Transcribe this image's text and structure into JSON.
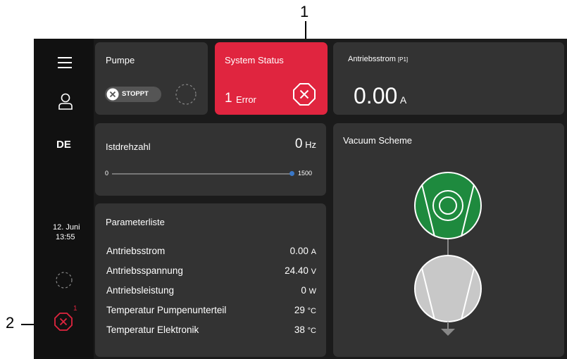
{
  "callouts": {
    "one": "1",
    "two": "2"
  },
  "sidebar": {
    "language": "DE",
    "date": "12. Juni",
    "time": "13:55",
    "error_badge": "1"
  },
  "pump": {
    "title": "Pumpe",
    "toggle_label": "STOPPT"
  },
  "system_status": {
    "title": "System Status",
    "count": "1",
    "label": "Error",
    "color": "#e0253f"
  },
  "drive_current": {
    "title": "Antriebsstrom",
    "tag": "[P1]",
    "value": "0.00",
    "unit": "A"
  },
  "speed": {
    "title": "Istdrehzahl",
    "value": "0",
    "unit": "Hz",
    "slider_min": "0",
    "slider_max": "1500",
    "slider_level": 1.0
  },
  "vacuum": {
    "title": "Vacuum Scheme",
    "upper_color": "#1e8a3e",
    "lower_color": "#c8c8c8"
  },
  "params": {
    "title": "Parameterliste",
    "rows": [
      {
        "name": "Antriebsstrom",
        "value": "0.00",
        "unit": "A"
      },
      {
        "name": "Antriebsspannung",
        "value": "24.40",
        "unit": "V"
      },
      {
        "name": "Antriebsleistung",
        "value": "0",
        "unit": "W"
      },
      {
        "name": "Temperatur Pumpenunterteil",
        "value": "29",
        "unit": "°C"
      },
      {
        "name": "Temperatur Elektronik",
        "value": "38",
        "unit": "°C"
      }
    ]
  }
}
